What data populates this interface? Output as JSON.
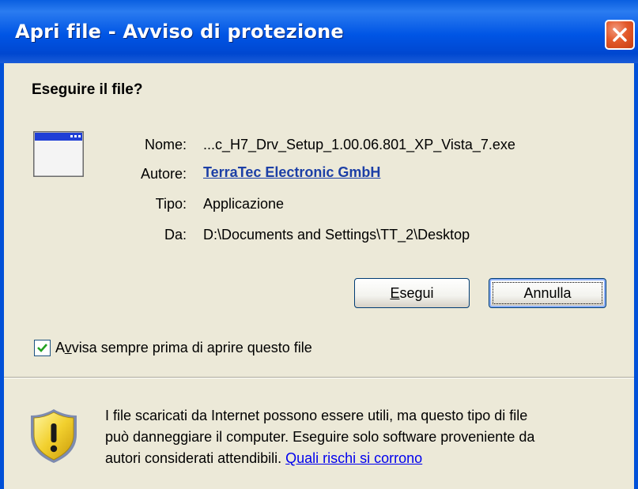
{
  "window": {
    "title": "Apri file - Avviso di protezione"
  },
  "heading": "Eseguire il file?",
  "fields": [
    {
      "label": "Nome:",
      "value": "...c_H7_Drv_Setup_1.00.06.801_XP_Vista_7.exe"
    },
    {
      "label": "Autore:",
      "value": "TerraTec Electronic GmbH"
    },
    {
      "label": "Tipo:",
      "value": "Applicazione"
    },
    {
      "label": "Da:",
      "value": "D:\\Documents and Settings\\TT_2\\Desktop"
    }
  ],
  "buttons": {
    "run": {
      "accel": "E",
      "rest": "segui"
    },
    "cancel": {
      "label": "Annulla"
    }
  },
  "checkbox": {
    "checked": true,
    "label_pre": "A",
    "accel": "v",
    "label_post": "visa sempre prima di aprire questo file"
  },
  "warning": {
    "line1": "I file scaricati da Internet possono essere utili, ma questo tipo di file",
    "line2": "può danneggiare il computer. Eseguire solo software proveniente da",
    "line3_text": "autori considerati attendibili. ",
    "link": "Quali rischi si corrono"
  },
  "icons": {
    "close": "close-icon",
    "app": "application-window-icon",
    "warning": "security-shield-warning-icon",
    "check": "checkmark-icon"
  },
  "colors": {
    "titlebar": "#0055e5",
    "close_button": "#e35a2b",
    "dialog_bg": "#ece9d8",
    "link": "#1c3fa6"
  }
}
